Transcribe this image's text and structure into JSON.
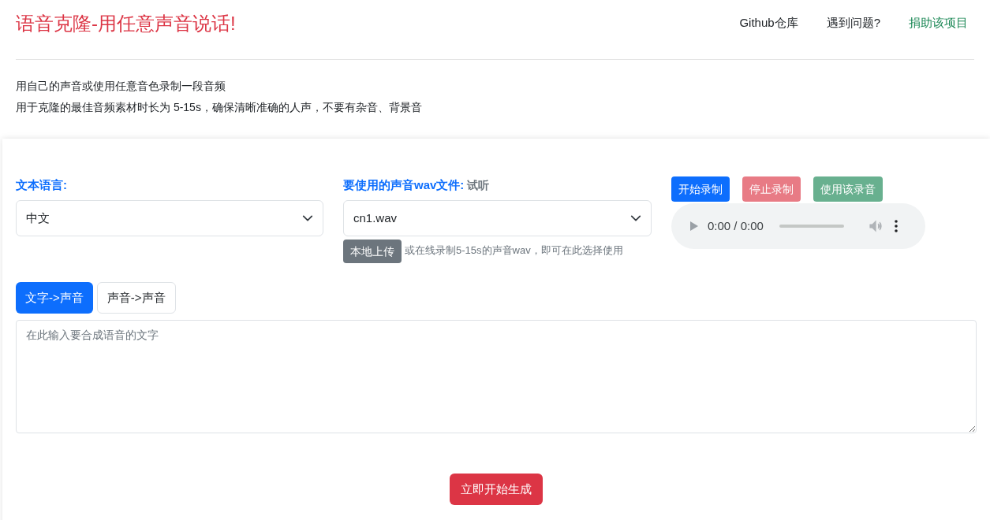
{
  "header": {
    "title": "语音克隆-用任意声音说话!",
    "nav": [
      {
        "label": "Github仓库",
        "kind": "plain"
      },
      {
        "label": "遇到问题?",
        "kind": "plain"
      },
      {
        "label": "捐助该项目",
        "kind": "accent"
      }
    ]
  },
  "intro": [
    "用自己的声音或使用任意音色录制一段音频",
    "用于克隆的最佳音频素材时长为 5-15s，确保清晰准确的人声，不要有杂音、背景音"
  ],
  "language": {
    "label": "文本语言:",
    "value": "中文"
  },
  "voice": {
    "label": "要使用的声音wav文件:",
    "preview_link": "试听",
    "value": "cn1.wav",
    "upload_button": "本地上传",
    "hint": "或在线录制5-15s的声音wav，即可在此选择使用"
  },
  "record_buttons": [
    {
      "label": "开始录制",
      "kind": "primary",
      "disabled": false
    },
    {
      "label": "停止录制",
      "kind": "danger",
      "disabled": true
    },
    {
      "label": "使用该录音",
      "kind": "success",
      "disabled": true
    }
  ],
  "player": {
    "time": "0:00 / 0:00"
  },
  "tabs": [
    {
      "label": "文字->声音",
      "selected": true
    },
    {
      "label": "声音->声音",
      "selected": false
    }
  ],
  "text_input": {
    "placeholder": "在此输入要合成语音的文字"
  },
  "generate_button": "立即开始生成"
}
